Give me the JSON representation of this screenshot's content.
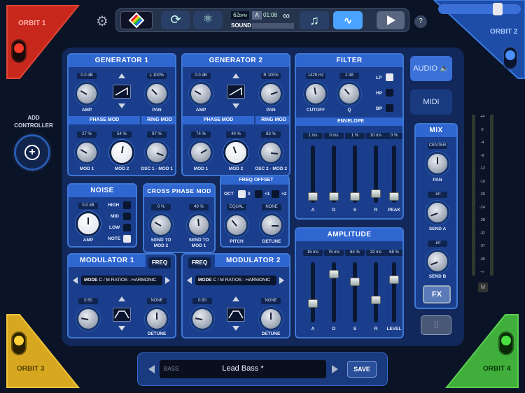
{
  "colors": {
    "accent": "#2f66d0",
    "orbit1": "#c8271c",
    "orbit2": "#2563c8",
    "orbit3": "#d7a71f",
    "orbit4": "#3fae3a"
  },
  "orbits": {
    "o1": "ORBIT 1",
    "o2": "ORBIT 2",
    "o3": "ORBIT 3",
    "o4": "ORBIT 4"
  },
  "add_controller": {
    "line1": "ADD",
    "line2": "CONTROLLER"
  },
  "transport": {
    "bpm": "62",
    "bpm_unit": "BPM",
    "key": "A",
    "time": "01:08",
    "sound_label": "SOUND",
    "help": "?"
  },
  "side_tabs": {
    "audio": "AUDIO",
    "midi": "MIDI"
  },
  "gen1": {
    "title": "GENERATOR 1",
    "amp_val": "0.0 dB",
    "pan_val": "L 100%",
    "amp": "AMP",
    "pan": "PAN",
    "phase_mod": "PHASE MOD",
    "ring_mod": "RING MOD",
    "m1_val": "27 %",
    "m2_val": "54 %",
    "osc_val": "97 %",
    "mod1": "MOD 1",
    "mod2": "MOD 2",
    "osc": "OSC 1 · MOD 1"
  },
  "gen2": {
    "title": "GENERATOR 2",
    "amp_val": "0.0 dB",
    "pan_val": "R 100%",
    "amp": "AMP",
    "pan": "PAN",
    "phase_mod": "PHASE MOD",
    "ring_mod": "RING MOD",
    "m1_val": "74 %",
    "m2_val": "40 %",
    "osc_val": "83 %",
    "mod1": "MOD 1",
    "mod2": "MOD 2",
    "osc": "OSC 2 · MOD 2"
  },
  "filter": {
    "title": "FILTER",
    "cutoff_val": "1429 Hz",
    "q_val": "2.38",
    "cutoff": "CUTOFF",
    "q": "Q",
    "lp": "LP",
    "hp": "HP",
    "bp": "BP",
    "envelope": "ENVELOPE",
    "env_vals": [
      "1 ms",
      "0 ms",
      "1 %",
      "10 ms",
      "0 %"
    ],
    "env_labels": [
      "A",
      "D",
      "S",
      "R",
      "PEAK"
    ],
    "env_levels": [
      0.05,
      0.05,
      0.05,
      0.1,
      0.05
    ]
  },
  "noise": {
    "title": "NOISE",
    "val": "0.0 dB",
    "amp": "AMP",
    "high": "HIGH",
    "mid": "MID",
    "low": "LOW",
    "note": "NOTE"
  },
  "cpm": {
    "title": "CROSS PHASE MOD",
    "v1": "0 %",
    "v2": "49 %",
    "l1a": "SEND TO",
    "l1b": "MOD 2",
    "l2a": "SEND TO",
    "l2b": "MOD 1"
  },
  "freq_offset": {
    "title": "FREQ OFFSET",
    "oct": "OCT",
    "o0": "0",
    "p1": "+1",
    "p2": "+2",
    "pitch_val": "EQUAL",
    "detune_val": "NONE",
    "pitch": "PITCH",
    "detune": "DETUNE"
  },
  "amplitude": {
    "title": "AMPLITUDE",
    "vals": [
      "16 ms",
      "75 ms",
      "64 %",
      "32 ms",
      "68 %"
    ],
    "labels": [
      "A",
      "D",
      "S",
      "R",
      "LEVEL"
    ],
    "levels": [
      0.28,
      0.85,
      0.7,
      0.35,
      0.75
    ]
  },
  "mix": {
    "title": "MIX",
    "pan_val": "CENTER",
    "pan": "PAN",
    "sa_val": "-inf",
    "sa": "SEND A",
    "sb_val": "-inf",
    "sb": "SEND B",
    "fx": "FX"
  },
  "mod1": {
    "title": "MODULATOR 1",
    "freq": "FREQ",
    "mode_label": "MODE",
    "mode": "C / M RATIOS : HARMONIC",
    "v1": "0.50",
    "v2": "NONE",
    "detune": "DETUNE"
  },
  "mod2": {
    "title": "MODULATOR 2",
    "freq": "FREQ",
    "mode_label": "MODE",
    "mode": "C / M RATIOS : HARMONIC",
    "v1": "0.50",
    "v2": "NONE",
    "detune": "DETUNE"
  },
  "meter": {
    "ticks": [
      "+4",
      "0",
      "-4",
      "-8",
      "-12",
      "-16",
      "-20",
      "-24",
      "-28",
      "-32",
      "-37",
      "-45",
      "-∞"
    ],
    "m": "M"
  },
  "preset": {
    "category": "BASS",
    "name": "Lead Bass *",
    "save": "SAVE"
  }
}
